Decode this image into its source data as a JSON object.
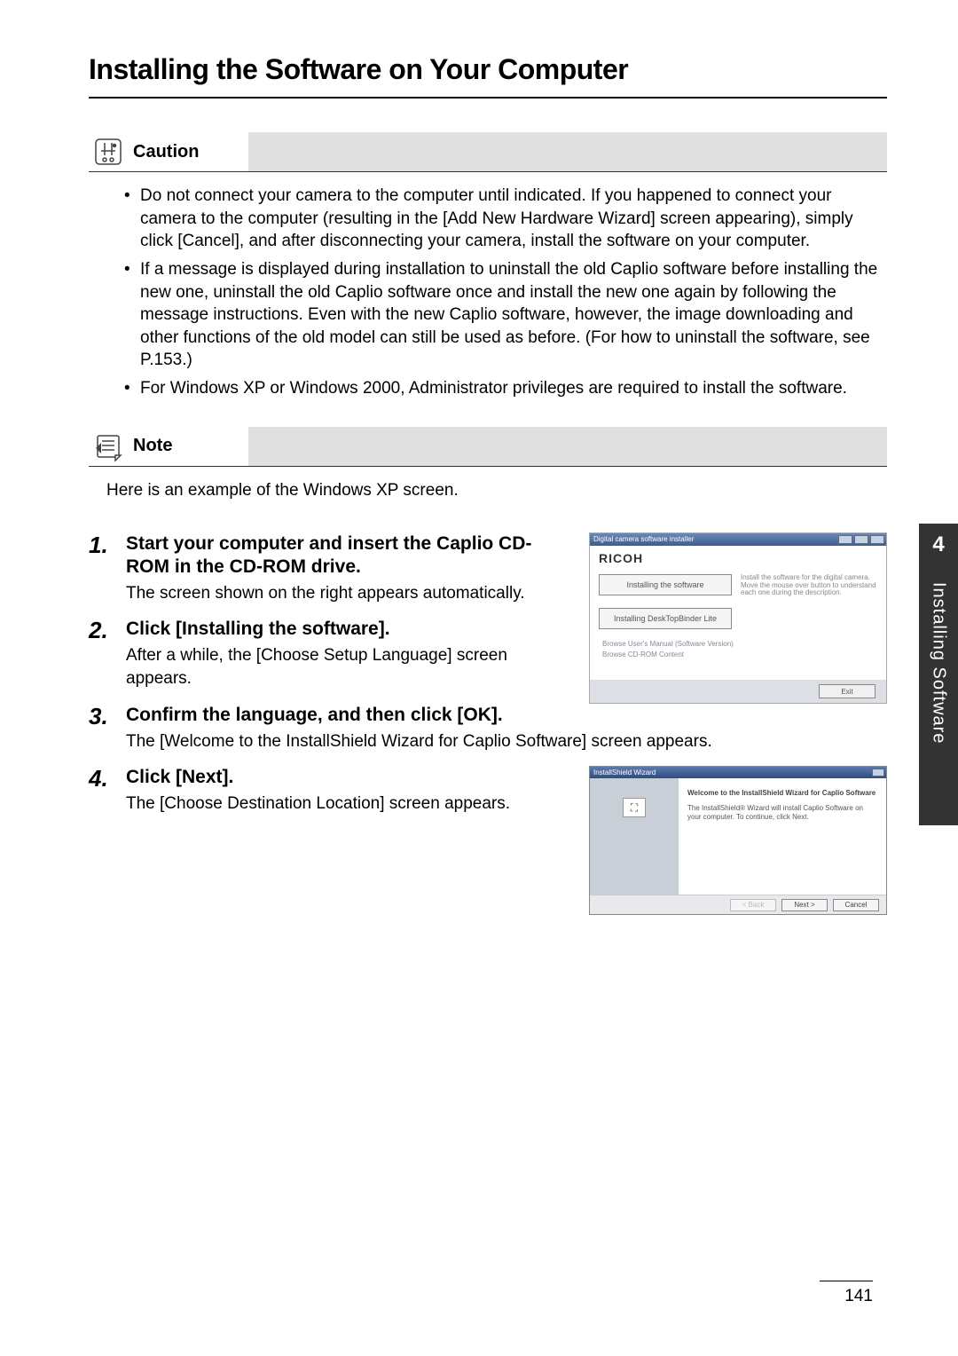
{
  "title": "Installing the Software on Your Computer",
  "chapter": {
    "number": "4",
    "name": "Installing Software"
  },
  "page_number": "141",
  "caution": {
    "label": "Caution",
    "items": [
      "Do not connect your camera to the computer until indicated. If you happened to connect your camera to the computer (resulting in the [Add New Hardware Wizard] screen appearing), simply click [Cancel], and after disconnecting your camera, install the software on your computer.",
      "If a message is displayed during installation to uninstall the old Caplio software before installing the new one, uninstall the old Caplio software once and install the new one again by following the message instructions. Even with the new Caplio software, however, the image downloading and other functions of the old model can still be used as before. (For how to uninstall the software, see P.153.)",
      "For Windows XP or Windows 2000, Administrator privileges are required to install the software."
    ]
  },
  "note": {
    "label": "Note",
    "text": "Here is an example of the Windows XP screen."
  },
  "steps": [
    {
      "num": "1",
      "title": "Start your computer and insert the Caplio CD-ROM in the CD-ROM drive.",
      "desc": "The screen shown on the right appears automatically."
    },
    {
      "num": "2",
      "title": "Click [Installing the software].",
      "desc": "After a while, the [Choose Setup Language] screen appears."
    },
    {
      "num": "3",
      "title": "Confirm the language, and then click [OK].",
      "desc": "The [Welcome to the InstallShield Wizard for Caplio Software] screen appears."
    },
    {
      "num": "4",
      "title": "Click [Next].",
      "desc": "The [Choose Destination Location] screen appears."
    }
  ],
  "screenshot1": {
    "titlebar": "Digital camera software installer",
    "brand": "RICOH",
    "btn1": "Installing the software",
    "btn1_desc": "Install the software for the digital camera. Move the mouse over button to understand each one during the description.",
    "btn2": "Installing DeskTopBinder Lite",
    "link1": "Browse User's Manual (Software Version)",
    "link2": "Browse CD-ROM Content",
    "exit": "Exit"
  },
  "screenshot2": {
    "titlebar": "InstallShield Wizard",
    "heading": "Welcome to the InstallShield Wizard for Caplio Software",
    "body": "The InstallShield® Wizard will install Caplio Software on your computer. To continue, click Next.",
    "back": "< Back",
    "next": "Next >",
    "cancel": "Cancel"
  }
}
